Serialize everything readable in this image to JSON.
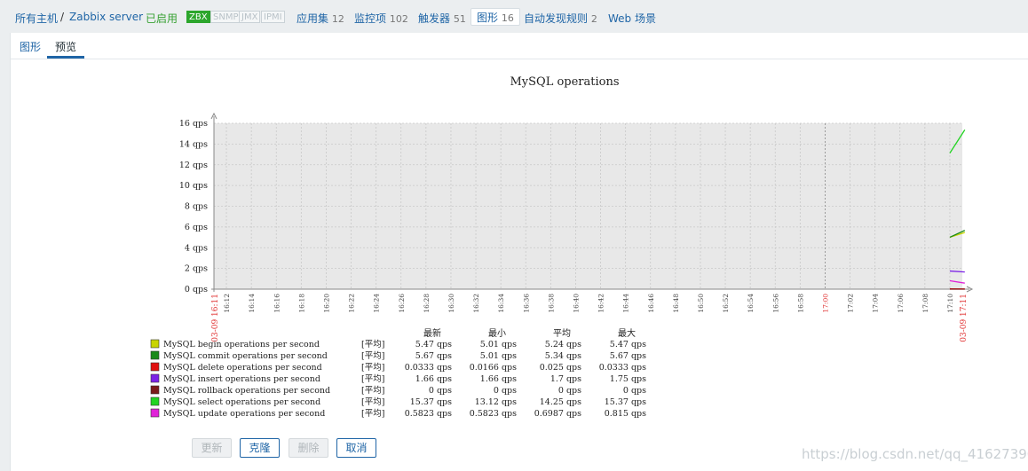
{
  "breadcrumb": {
    "all_hosts": "所有主机",
    "separator": "/",
    "host": "Zabbix server"
  },
  "status": {
    "enabled": "已启用",
    "tags": [
      "ZBX",
      "SNMP",
      "JMX",
      "IPMI"
    ]
  },
  "host_nav": [
    {
      "label": "应用集",
      "count": "12"
    },
    {
      "label": "监控项",
      "count": "102"
    },
    {
      "label": "触发器",
      "count": "51"
    },
    {
      "label": "图形",
      "count": "16"
    },
    {
      "label": "自动发现规则",
      "count": "2"
    },
    {
      "label": "Web 场景",
      "count": ""
    }
  ],
  "tabs": {
    "graph": "图形",
    "preview": "预览"
  },
  "chart_data": {
    "type": "line",
    "title": "MySQL operations",
    "y_ticks": [
      "0 qps",
      "2 qps",
      "4 qps",
      "6 qps",
      "8 qps",
      "10 qps",
      "12 qps",
      "14 qps",
      "16 qps"
    ],
    "ylim": [
      0,
      16
    ],
    "y_unit": "qps",
    "x_ticks": [
      "16:12",
      "16:14",
      "16:16",
      "16:18",
      "16:20",
      "16:22",
      "16:24",
      "16:26",
      "16:28",
      "16:30",
      "16:32",
      "16:34",
      "16:36",
      "16:38",
      "16:40",
      "16:42",
      "16:44",
      "16:46",
      "16:48",
      "16:50",
      "16:52",
      "16:54",
      "16:56",
      "16:58",
      "17:00",
      "17:02",
      "17:04",
      "17:06",
      "17:08",
      "17:10"
    ],
    "x_start_label": "03-09 16:11",
    "x_end_label": "03-09 17:11",
    "xlim_minutes": [
      0,
      60
    ],
    "grid": true,
    "series": [
      {
        "name": "MySQL begin operations per second",
        "color": "#c8d400",
        "x": [
          59.0,
          60.2
        ],
        "values": [
          5.01,
          5.47
        ]
      },
      {
        "name": "MySQL commit operations per second",
        "color": "#1b8a1b",
        "x": [
          59.0,
          60.2
        ],
        "values": [
          5.01,
          5.67
        ]
      },
      {
        "name": "MySQL delete operations per second",
        "color": "#e01010",
        "x": [
          59.0,
          60.2
        ],
        "values": [
          0.0333,
          0.0166
        ]
      },
      {
        "name": "MySQL insert operations per second",
        "color": "#7b22e6",
        "x": [
          59.0,
          60.2
        ],
        "values": [
          1.75,
          1.66
        ]
      },
      {
        "name": "MySQL rollback operations per second",
        "color": "#7a1a1a",
        "x": [
          59.0,
          60.2
        ],
        "values": [
          0,
          0
        ]
      },
      {
        "name": "MySQL select operations per second",
        "color": "#22d422",
        "x": [
          59.0,
          60.2
        ],
        "values": [
          13.12,
          15.37
        ]
      },
      {
        "name": "MySQL update operations per second",
        "color": "#e022d8",
        "x": [
          59.0,
          60.2
        ],
        "values": [
          0.815,
          0.5823
        ]
      }
    ],
    "legend_headers": [
      "最新",
      "最小",
      "平均",
      "最大"
    ],
    "legend_rows": [
      {
        "name": "MySQL begin operations per second",
        "func": "[平均]",
        "last": "5.47 qps",
        "min": "5.01 qps",
        "avg": "5.24 qps",
        "max": "5.47 qps"
      },
      {
        "name": "MySQL commit operations per second",
        "func": "[平均]",
        "last": "5.67 qps",
        "min": "5.01 qps",
        "avg": "5.34 qps",
        "max": "5.67 qps"
      },
      {
        "name": "MySQL delete operations per second",
        "func": "[平均]",
        "last": "0.0333 qps",
        "min": "0.0166 qps",
        "avg": "0.025 qps",
        "max": "0.0333 qps"
      },
      {
        "name": "MySQL insert operations per second",
        "func": "[平均]",
        "last": "1.66 qps",
        "min": "1.66 qps",
        "avg": "1.7 qps",
        "max": "1.75 qps"
      },
      {
        "name": "MySQL rollback operations per second",
        "func": "[平均]",
        "last": "0 qps",
        "min": "0 qps",
        "avg": "0 qps",
        "max": "0 qps"
      },
      {
        "name": "MySQL select operations per second",
        "func": "[平均]",
        "last": "15.37 qps",
        "min": "13.12 qps",
        "avg": "14.25 qps",
        "max": "15.37 qps"
      },
      {
        "name": "MySQL update operations per second",
        "func": "[平均]",
        "last": "0.5823 qps",
        "min": "0.5823 qps",
        "avg": "0.6987 qps",
        "max": "0.815 qps"
      }
    ]
  },
  "buttons": {
    "update": "更新",
    "clone": "克隆",
    "delete": "删除",
    "cancel": "取消"
  },
  "watermark": "https://blog.csdn.net/qq_41627390"
}
